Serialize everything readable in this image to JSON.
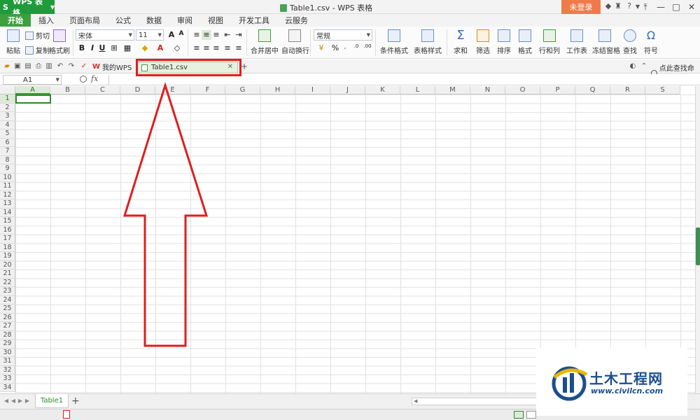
{
  "titlebar": {
    "app_name": "WPS 表格",
    "window_title": "Table1.csv - WPS 表格",
    "login_label": "未登录",
    "help_label": "?",
    "minimize_label": "—",
    "maximize_label": "□",
    "close_label": "✕"
  },
  "ribbon_tabs": [
    "开始",
    "插入",
    "页面布局",
    "公式",
    "数据",
    "审阅",
    "视图",
    "开发工具",
    "云服务"
  ],
  "ribbon": {
    "paste_label": "粘贴",
    "cut_label": "剪切",
    "copy_label": "复制",
    "format_painter_label": "格式刷",
    "font_name": "宋体",
    "font_size": "11",
    "merge_center_label": "合并居中",
    "auto_wrap_label": "自动换行",
    "number_format": "常规",
    "conditional_format_label": "条件格式",
    "table_style_label": "表格样式",
    "sum_label": "求和",
    "filter_label": "筛选",
    "sort_label": "排序",
    "format_label": "格式",
    "row_col_label": "行和列",
    "worksheet_label": "工作表",
    "freeze_label": "冻结窗格",
    "find_label": "查找",
    "symbol_label": "符号",
    "bold": "B",
    "italic": "I",
    "underline": "U",
    "percent": "%"
  },
  "quick_access": {
    "my_wps_label": "我的WPS",
    "doc_tab_label": "Table1.csv",
    "search_command_label": "点此查找命令"
  },
  "formula_bar": {
    "name_box": "A1",
    "fx_label": "fx",
    "value": ""
  },
  "grid": {
    "columns": [
      "A",
      "B",
      "C",
      "D",
      "E",
      "F",
      "G",
      "H",
      "I",
      "J",
      "K",
      "L",
      "M",
      "N",
      "O",
      "P",
      "Q",
      "R",
      "S"
    ],
    "rows": [
      "1",
      "2",
      "3",
      "4",
      "5",
      "6",
      "7",
      "8",
      "9",
      "10",
      "11",
      "12",
      "13",
      "14",
      "15",
      "16",
      "17",
      "18",
      "19",
      "20",
      "21",
      "22",
      "23",
      "24",
      "25",
      "26",
      "27",
      "28",
      "29",
      "30",
      "31",
      "32",
      "33",
      "34"
    ],
    "active_cell": "A1"
  },
  "sheetbar": {
    "sheet_tab_label": "Table1",
    "add_sheet_label": "+"
  },
  "watermark": {
    "name": "土木工程网",
    "url": "www.civilcn.com"
  },
  "colors": {
    "app_green": "#1f9b3b",
    "login_orange": "#f07b4a",
    "annotation_red": "#e01e1e",
    "watermark_blue": "#1b4f8c"
  }
}
